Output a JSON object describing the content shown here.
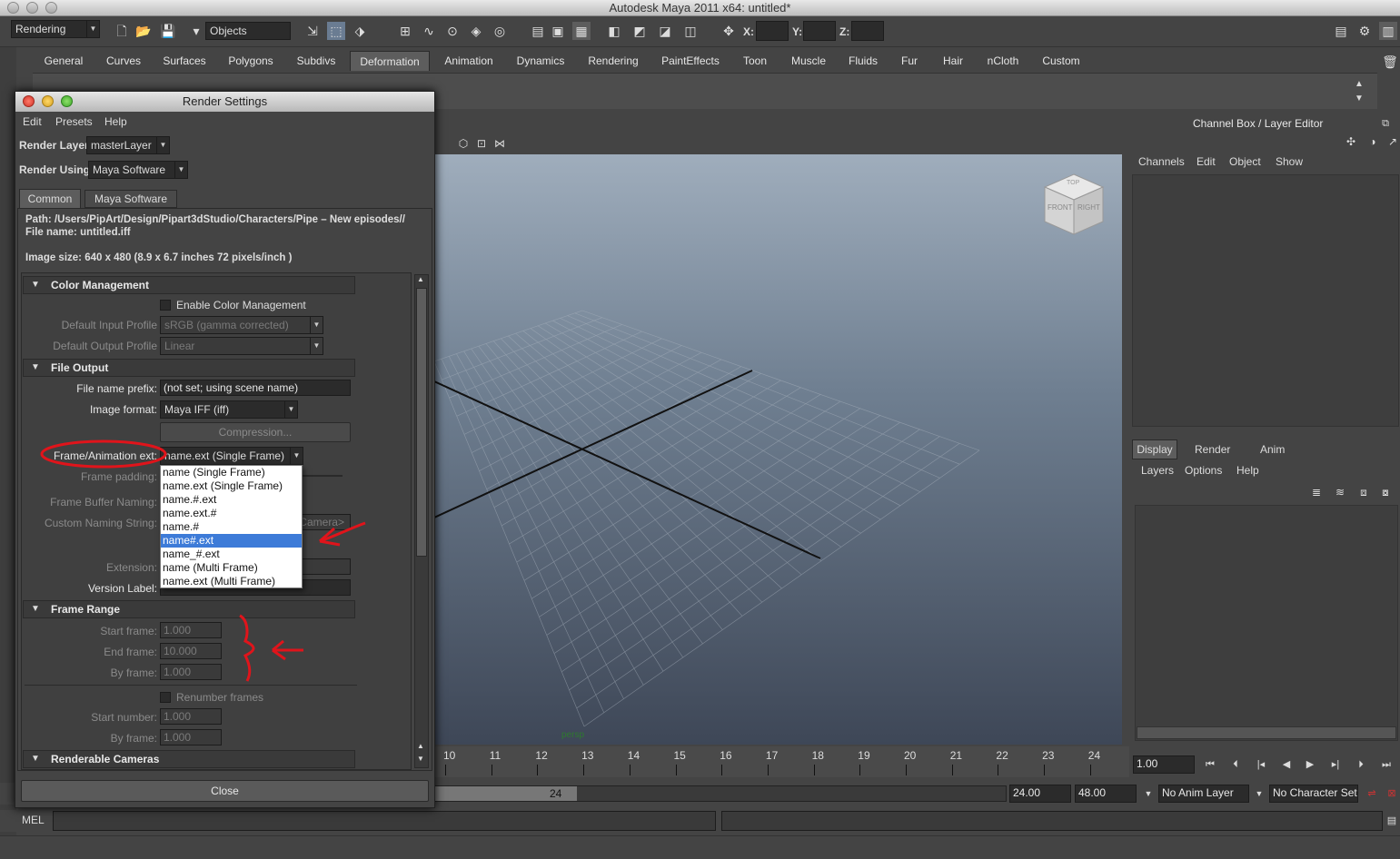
{
  "window_title": "Autodesk Maya 2011 x64: untitled*",
  "toolbar": {
    "menu_set": "Rendering",
    "selection_mode": "Objects",
    "x_label": "X:",
    "y_label": "Y:",
    "z_label": "Z:"
  },
  "shelf_tabs": [
    "General",
    "Curves",
    "Surfaces",
    "Polygons",
    "Subdivs",
    "Deformation",
    "Animation",
    "Dynamics",
    "Rendering",
    "PaintEffects",
    "Toon",
    "Muscle",
    "Fluids",
    "Fur",
    "Hair",
    "nCloth",
    "Custom"
  ],
  "shelf_active": "Deformation",
  "render_settings": {
    "title": "Render Settings",
    "menu": [
      "Edit",
      "Presets",
      "Help"
    ],
    "render_layer_label": "Render Layer",
    "render_layer_value": "masterLayer",
    "render_using_label": "Render Using",
    "render_using_value": "Maya Software",
    "tabs": [
      "Common",
      "Maya Software"
    ],
    "path_line": "Path: /Users/PipArt/Design/Pipart3dStudio/Characters/Pipe – New episodes//",
    "file_name_line": "File name:  untitled.iff",
    "image_size_line": "Image size: 640 x 480 (8.9 x 6.7 inches 72 pixels/inch )",
    "color_management": {
      "header": "Color Management",
      "enable_label": "Enable Color Management",
      "input_profile_label": "Default Input Profile",
      "input_profile_value": "sRGB (gamma corrected)",
      "output_profile_label": "Default Output Profile",
      "output_profile_value": "Linear"
    },
    "file_output": {
      "header": "File Output",
      "prefix_label": "File name prefix:",
      "prefix_value": "(not set; using scene name)",
      "format_label": "Image format:",
      "format_value": "Maya IFF (iff)",
      "compression_label": "Compression...",
      "frame_ext_label": "Frame/Animation ext:",
      "frame_ext_value": "name.ext (Single Frame)",
      "frame_padding_label": "Frame padding:",
      "frame_buffer_label": "Frame Buffer Naming:",
      "custom_naming_label": "Custom Naming String:",
      "custom_naming_value": "<Camera>",
      "extension_label": "Extension:",
      "version_label": "Version Label:"
    },
    "frame_ext_options": [
      "name (Single Frame)",
      "name.ext (Single Frame)",
      "name.#.ext",
      "name.ext.#",
      "name.#",
      "name#.ext",
      "name_#.ext",
      "name (Multi Frame)",
      "name.ext (Multi Frame)"
    ],
    "frame_ext_highlight": "name#.ext",
    "frame_range": {
      "header": "Frame Range",
      "start_label": "Start frame:",
      "start_value": "1.000",
      "end_label": "End frame:",
      "end_value": "10.000",
      "by_label": "By frame:",
      "by_value": "1.000",
      "renumber_label": "Renumber frames",
      "start_number_label": "Start number:",
      "start_number_value": "1.000",
      "by_frame2_label": "By frame:",
      "by_frame2_value": "1.000"
    },
    "renderable_cameras_header": "Renderable Cameras",
    "close_label": "Close"
  },
  "viewport": {
    "camera_label": "persp",
    "viewcube_front": "FRONT",
    "viewcube_right": "RIGHT",
    "viewcube_top": "TOP"
  },
  "timeline": {
    "ticks": [
      "10",
      "11",
      "12",
      "13",
      "14",
      "15",
      "16",
      "17",
      "18",
      "19",
      "20",
      "21",
      "22",
      "23",
      "24"
    ],
    "current_frame": "1.00"
  },
  "range": {
    "slider_value": "24",
    "end_time": "24.00",
    "end_range": "48.00",
    "anim_layer": "No Anim Layer",
    "character_set": "No Character Set"
  },
  "mel_label": "MEL",
  "channel_box": {
    "title": "Channel Box / Layer Editor",
    "menu": [
      "Channels",
      "Edit",
      "Object",
      "Show"
    ],
    "layer_tabs": [
      "Display",
      "Render",
      "Anim"
    ],
    "layer_menu": [
      "Layers",
      "Options",
      "Help"
    ]
  }
}
